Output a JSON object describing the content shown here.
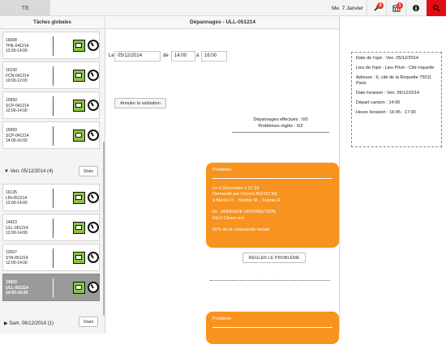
{
  "topbar": {
    "tab_label": "TB",
    "date": "Me. 7 Janvier",
    "badges": {
      "wrench": "9",
      "grid": "1"
    },
    "icons": [
      "wrench-icon",
      "calendar-grid-icon",
      "info-icon",
      "search-icon"
    ],
    "accent_color": "#e30b14"
  },
  "left": {
    "title": "Tâches globales",
    "cards_top": [
      {
        "l1": "16008",
        "l2": "THE-041214",
        "l3": "12:00-14:00",
        "icon": "car-icon"
      },
      {
        "l1": "16230",
        "l2": "FCN-041214",
        "l3": "10:00-12:00",
        "icon": "car-icon"
      },
      {
        "l1": "15950",
        "l2": "SCP-041214",
        "l3": "12:00-14:00",
        "icon": "car-icon"
      },
      {
        "l1": "15950",
        "l2": "SCP-041214",
        "l3": "14:00-16:00",
        "icon": "van-icon"
      }
    ],
    "group1": {
      "header": "▼ Ven. 05/12/2014 (4)",
      "stats": "Stats"
    },
    "cards_group1": [
      {
        "l1": "16135",
        "l2": "LIN-051214",
        "l3": "12:00-14:00",
        "icon": "car-icon"
      },
      {
        "l1": "14923",
        "l2": "ULL-051214",
        "l3": "12:00-14:00",
        "icon": "car-icon"
      },
      {
        "l1": "12507",
        "l2": "STA-051214",
        "l3": "12:00-14:00",
        "icon": "car-icon"
      },
      {
        "l1": "14923",
        "l2": "ULL-051214",
        "l3": "14:00-16:00",
        "icon": "van-icon",
        "selected": true
      }
    ],
    "group2": {
      "header": "▶ Sam. 06/12/2014 (1)",
      "stats": "Stats"
    }
  },
  "main": {
    "title": "Dépannages - ULL-051214",
    "le_label": "Le",
    "date_value": "05/12/2014",
    "de_label": "de",
    "start_value": "14:00",
    "a_label": "à",
    "end_value": "16:00",
    "cancel_button": "Annuler la validation",
    "counts": [
      "Dépannages effectués : 0/0",
      "Problèmes réglés : 0/2"
    ],
    "problem1": {
      "header": "Problème",
      "lines": [
        "Le 4 Décembre à 07:33",
        "Demandé par Florent AGOSTINI",
        "à Martin O. , Sophie M. , Sophie R."
      ],
      "lines2": [
        "fm : ANDRADE DISTRIBUTION",
        "KILO Citron vert"
      ],
      "lines3": [
        "50% de la commande moisie"
      ]
    },
    "fix_button": "RÉGLER LE PROBLÈME",
    "problem2": {
      "header": "Problème"
    }
  },
  "info": {
    "items": [
      "Date de l'opé : Ven. 05/12/2014",
      "Lieu de l'opé : Lieu Privé - Cité roquette",
      "Adresse : 6, cité de la Roquette 75011 Paris",
      "Date livraison : Ven. 05/12/2014",
      "Départ camion : 14:00",
      "Heure livraison : 16:45 - 17:00"
    ]
  }
}
